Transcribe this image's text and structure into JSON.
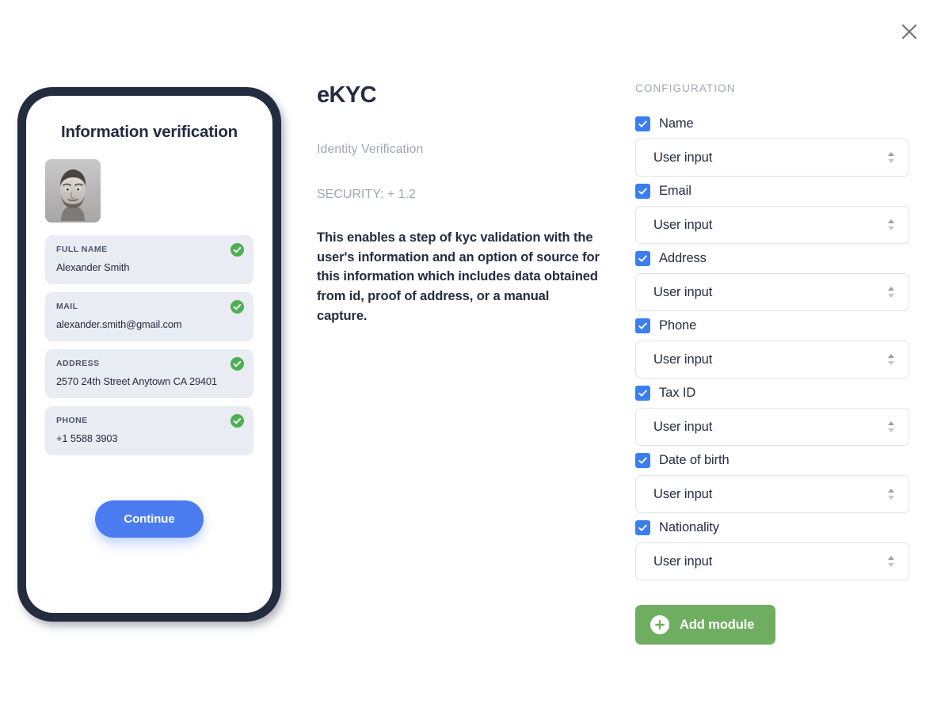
{
  "close_label": "×",
  "phone": {
    "title": "Information verification",
    "avatar_alt": "portrait-photo",
    "fields": [
      {
        "label": "FULL NAME",
        "value": "Alexander Smith",
        "verified": true
      },
      {
        "label": "MAIL",
        "value": "alexander.smith@gmail.com",
        "verified": true
      },
      {
        "label": "ADDRESS",
        "value": "2570 24th Street Anytown CA 29401",
        "verified": true
      },
      {
        "label": "PHONE",
        "value": "+1 5588 3903",
        "verified": true
      }
    ],
    "continue_label": "Continue"
  },
  "detail": {
    "title": "eKYC",
    "subtitle": "Identity Verification",
    "security": "SECURITY: + 1.2",
    "description": "This enables a step of kyc validation with the user's information and an option of source for this information which includes data obtained from id, proof of address, or a manual capture."
  },
  "configuration": {
    "heading": "CONFIGURATION",
    "items": [
      {
        "label": "Name",
        "checked": true,
        "source": "User input"
      },
      {
        "label": "Email",
        "checked": true,
        "source": "User input"
      },
      {
        "label": "Address",
        "checked": true,
        "source": "User input"
      },
      {
        "label": "Phone",
        "checked": true,
        "source": "User input"
      },
      {
        "label": "Tax ID",
        "checked": true,
        "source": "User input"
      },
      {
        "label": "Date of birth",
        "checked": true,
        "source": "User input"
      },
      {
        "label": "Nationality",
        "checked": true,
        "source": "User input"
      }
    ],
    "add_module_label": "Add module"
  },
  "colors": {
    "accent_blue": "#3b7ef0",
    "continue_blue": "#4a7cf0",
    "green_check": "#4caf50",
    "add_module_green": "#6fae61",
    "phone_frame": "#242c3f",
    "card_bg": "#e9ecf2",
    "muted_text": "#a3a7b2"
  }
}
